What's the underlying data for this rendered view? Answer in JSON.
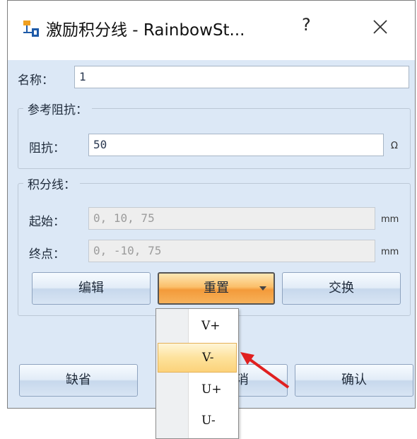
{
  "window": {
    "title": "激励积分线 - RainbowSt...",
    "help_label": "?",
    "close_label": "×"
  },
  "name_row": {
    "label": "名称：",
    "value": "1"
  },
  "reference_impedance": {
    "legend": "参考阻抗：",
    "label": "阻抗：",
    "value": "50",
    "unit": "Ω"
  },
  "integration_line": {
    "legend": "积分线：",
    "start_label": "起始：",
    "start_value": "0, 10, 75",
    "start_unit": "mm",
    "end_label": "终点：",
    "end_value": "0, -10, 75",
    "end_unit": "mm",
    "edit_button": "编辑",
    "reset_button": "重置",
    "swap_button": "交换"
  },
  "footer": {
    "default_button": "缺省",
    "cancel_button_partial": "消",
    "ok_button": "确认"
  },
  "reset_menu": {
    "items": [
      "V+",
      "V-",
      "U+",
      "U-"
    ],
    "highlighted": "V-"
  },
  "colors": {
    "client_bg": "#dce8f6",
    "active_button": "#f39a3a",
    "highlight_menu": "#fde29c",
    "annotation_arrow": "#e02020"
  }
}
